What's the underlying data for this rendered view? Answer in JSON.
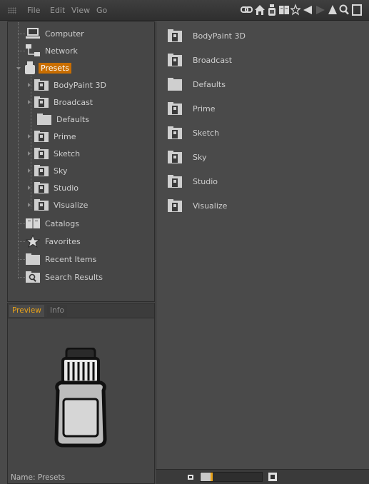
{
  "menu": {
    "items": [
      "File",
      "Edit",
      "View",
      "Go"
    ]
  },
  "toolbar": {
    "icons": [
      "chain-link-icon",
      "home-icon",
      "bottle-icon",
      "book-icon",
      "star-icon",
      "back-arrow-icon",
      "forward-arrow-icon",
      "up-arrow-icon",
      "search-icon",
      "panel-icon"
    ]
  },
  "tree": {
    "items": [
      {
        "label": "Computer",
        "icon": "computer-icon"
      },
      {
        "label": "Network",
        "icon": "network-icon"
      },
      {
        "label": "Presets",
        "icon": "bottle-icon",
        "selected": true,
        "expanded": true
      },
      {
        "label": "BodyPaint 3D",
        "icon": "preset-folder-icon"
      },
      {
        "label": "Broadcast",
        "icon": "preset-folder-icon"
      },
      {
        "label": "Defaults",
        "icon": "folder-icon"
      },
      {
        "label": "Prime",
        "icon": "preset-folder-icon"
      },
      {
        "label": "Sketch",
        "icon": "preset-folder-icon"
      },
      {
        "label": "Sky",
        "icon": "preset-folder-icon"
      },
      {
        "label": "Studio",
        "icon": "preset-folder-icon"
      },
      {
        "label": "Visualize",
        "icon": "preset-folder-icon"
      },
      {
        "label": "Catalogs",
        "icon": "book-icon"
      },
      {
        "label": "Favorites",
        "icon": "star-icon"
      },
      {
        "label": "Recent Items",
        "icon": "folder-icon"
      },
      {
        "label": "Search Results",
        "icon": "search-folder-icon"
      }
    ]
  },
  "preview": {
    "tabs": [
      "Preview",
      "Info"
    ],
    "active_tab": "Preview",
    "name_line": "Name: Presets"
  },
  "content": {
    "items": [
      {
        "label": "BodyPaint 3D",
        "icon": "preset-folder-icon"
      },
      {
        "label": "Broadcast",
        "icon": "preset-folder-icon"
      },
      {
        "label": "Defaults",
        "icon": "folder-icon"
      },
      {
        "label": "Prime",
        "icon": "preset-folder-icon"
      },
      {
        "label": "Sketch",
        "icon": "preset-folder-icon"
      },
      {
        "label": "Sky",
        "icon": "preset-folder-icon"
      },
      {
        "label": "Studio",
        "icon": "preset-folder-icon"
      },
      {
        "label": "Visualize",
        "icon": "preset-folder-icon"
      }
    ]
  },
  "status": {
    "zoom_fraction": 0.18
  },
  "colors": {
    "accent": "#e8a21a",
    "selection": "#c96e00",
    "panel_bg": "#464646",
    "menubar_bg": "#333333"
  }
}
